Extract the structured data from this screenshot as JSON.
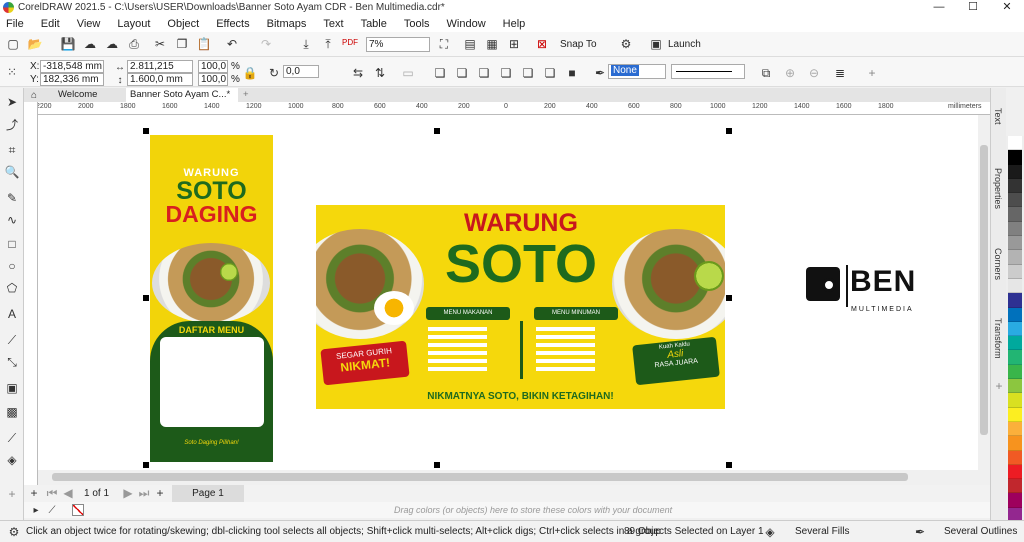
{
  "window": {
    "title": "CorelDRAW 2021.5 - C:\\Users\\USER\\Downloads\\Banner Soto Ayam CDR - Ben Multimedia.cdr*",
    "minimize": "—",
    "maximize": "☐",
    "close": "✕"
  },
  "menu": [
    "File",
    "Edit",
    "View",
    "Layout",
    "Object",
    "Effects",
    "Bitmaps",
    "Text",
    "Table",
    "Tools",
    "Window",
    "Help"
  ],
  "toolbar": {
    "zoom": "7%",
    "snap_to": "Snap To",
    "launch": "Launch",
    "pdf_label": "PDF"
  },
  "propbar": {
    "x_label": "X:",
    "x_value": "-318,548 mm",
    "y_label": "Y:",
    "y_value": "182,336 mm",
    "w_value": "2.811,215 mm",
    "h_value": "1.600,0 mm",
    "scale_x": "100,0",
    "scale_y": "100,0",
    "pct": "%",
    "angle": "0,0",
    "outline": "None"
  },
  "tabs": {
    "welcome": "Welcome Screen",
    "document": "Banner Soto Ayam C...*",
    "add": "+"
  },
  "ruler": {
    "ticks": [
      "2200",
      "2000",
      "1800",
      "1600",
      "1400",
      "1200",
      "1000",
      "800",
      "600",
      "400",
      "200",
      "0",
      "200",
      "400",
      "600",
      "800",
      "1000",
      "1200",
      "1400",
      "1600",
      "1800"
    ],
    "unit": "millimeters"
  },
  "banner_vertical": {
    "warung": "WARUNG",
    "soto": "SOTO",
    "daging": "DAGING",
    "menu_title": "DAFTAR MENU",
    "tagline": "Soto Daging Pilihan!"
  },
  "banner_horizontal": {
    "warung": "WARUNG",
    "soto": "SOTO",
    "menu_food": "MENU MAKANAN",
    "menu_drink": "MENU MINUMAN",
    "badge_left_1": "SEGAR GURIH",
    "badge_left_2": "NIKMAT!",
    "badge_right_1": "Kuah Kaldu",
    "badge_right_2": "Asli",
    "badge_right_3": "RASA JUARA",
    "footer": "NIKMATNYA SOTO, BIKIN KETAGIHAN!"
  },
  "logo": {
    "brand": "BEN",
    "sub": "MULTIMEDIA"
  },
  "docker_tabs": [
    "Text",
    "Properties",
    "Corners",
    "Transform"
  ],
  "palette": [
    "#ffffff",
    "#000000",
    "#1a1a1a",
    "#333333",
    "#4d4d4d",
    "#666666",
    "#808080",
    "#999999",
    "#b3b3b3",
    "#cccccc",
    "#e6e6e6",
    "#2e3192",
    "#0071bc",
    "#29abe2",
    "#00a99d",
    "#22b573",
    "#39b54a",
    "#8cc63f",
    "#d9e021",
    "#fcee21",
    "#fbb03b",
    "#f7931e",
    "#f15a24",
    "#ed1c24",
    "#c1272d",
    "#9e005d",
    "#93278f",
    "#662d91"
  ],
  "page_nav": {
    "page_count": "1 of 1",
    "page_tab": "Page 1"
  },
  "color_hint": "Drag colors (or objects) here to store these colors with your document",
  "status": {
    "hint": "Click an object twice for rotating/skewing; dbl-clicking tool selects all objects; Shift+click multi-selects; Alt+click digs; Ctrl+click selects in a group",
    "selection": "89 Objects Selected on Layer 1",
    "fill": "Several Fills",
    "outline": "Several Outlines"
  }
}
